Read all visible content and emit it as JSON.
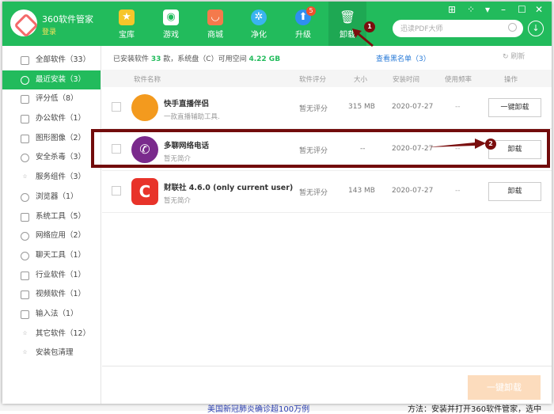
{
  "app": {
    "name": "360软件管家",
    "login": "登录"
  },
  "nav": [
    {
      "label": "宝库",
      "icon": "star-icon"
    },
    {
      "label": "游戏",
      "icon": "gamepad-icon"
    },
    {
      "label": "商城",
      "icon": "shop-bag-icon"
    },
    {
      "label": "净化",
      "icon": "fan-icon"
    },
    {
      "label": "升级",
      "icon": "upgrade-arrow-icon",
      "badge": "5"
    },
    {
      "label": "卸载",
      "icon": "trash-icon",
      "active": true
    }
  ],
  "search": {
    "placeholder": "迅读PDF大师"
  },
  "sidebar": [
    {
      "label": "全部软件（33）"
    },
    {
      "label": "最近安装（3）",
      "active": true
    },
    {
      "label": "评分低（8）"
    },
    {
      "label": "办公软件（1）"
    },
    {
      "label": "图形图像（2）"
    },
    {
      "label": "安全杀毒（3）"
    },
    {
      "label": "服务组件（3）"
    },
    {
      "label": "浏览器（1）"
    },
    {
      "label": "系统工具（5）"
    },
    {
      "label": "网络应用（2）"
    },
    {
      "label": "聊天工具（1）"
    },
    {
      "label": "行业软件（1）"
    },
    {
      "label": "视频软件（1）"
    },
    {
      "label": "输入法（1）"
    },
    {
      "label": "其它软件（12）"
    },
    {
      "label": "安装包清理"
    }
  ],
  "info": {
    "prefix": "已安装软件",
    "count": "33",
    "mid": "款，系统盘（C）可用空间",
    "space": "4.22 GB",
    "blacklist": "查看黑名单（3）",
    "refresh": "刷新"
  },
  "table": {
    "headers": [
      "软件名称",
      "软件评分",
      "大小",
      "安装时间",
      "使用频率",
      "操作"
    ],
    "rows": [
      {
        "name": "快手直播伴侣",
        "desc": "一款直播辅助工具.",
        "rating": "暂无评分",
        "size": "315 MB",
        "date": "2020-07-27",
        "freq": "--",
        "action": "一键卸载",
        "color": "#f39a1e"
      },
      {
        "name": "多聊网络电话",
        "desc": "暂无简介",
        "rating": "暂无评分",
        "size": "--",
        "date": "2020-07-27",
        "freq": "--",
        "action": "卸载",
        "color": "#7a2a8c"
      },
      {
        "name": "财联社 4.6.0 (only current user)",
        "desc": "暂无简介",
        "rating": "暂无评分",
        "size": "143 MB",
        "date": "2020-07-27",
        "freq": "--",
        "action": "卸载",
        "color": "#e8332a"
      }
    ]
  },
  "footer": {
    "button": "一键卸载"
  },
  "annotations": [
    "1",
    "2"
  ],
  "background": {
    "left": "美国新冠肺炎确诊超100万例",
    "right": "方法：安装并打开360软件管家，选中"
  }
}
